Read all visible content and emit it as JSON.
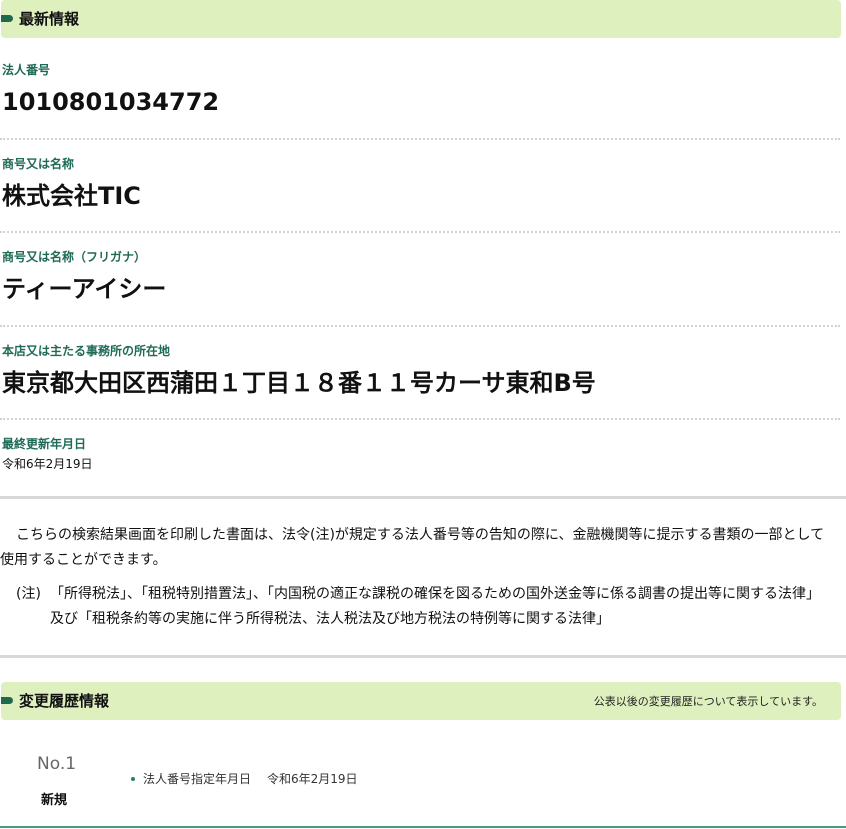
{
  "latest_info": {
    "header_title": "最新情報",
    "fields": [
      {
        "label": "法人番号",
        "value": "1010801034772"
      },
      {
        "label": "商号又は名称",
        "value": "株式会社TIC"
      },
      {
        "label": "商号又は名称（フリガナ）",
        "value": "ティーアイシー"
      },
      {
        "label": "本店又は主たる事務所の所在地",
        "value": "東京都大田区西蒲田１丁目１８番１１号カーサ東和B号"
      },
      {
        "label": "最終更新年月日",
        "value": "令和6年2月19日"
      }
    ]
  },
  "notice": {
    "paragraph": "こちらの検索結果画面を印刷した書面は、法令(注)が規定する法人番号等の告知の際に、金融機関等に提示する書類の一部として使用することができます。",
    "note_mark": "(注)",
    "note_text": "「所得税法」、「租税特別措置法」、「内国税の適正な課税の確保を図るための国外送金等に係る調書の提出等に関する法律」及び「租税条約等の実施に伴う所得税法、法人税法及び地方税法の特例等に関する法律」"
  },
  "history": {
    "header_title": "変更履歴情報",
    "header_note": "公表以後の変更履歴について表示しています。",
    "entries": [
      {
        "number": "No.1",
        "status": "新規",
        "item_label": "法人番号指定年月日",
        "item_value": "令和6年2月19日"
      }
    ]
  },
  "colors": {
    "header_bg": "#dff0bf",
    "marker": "#1f6a4f",
    "label": "#1e6a56",
    "bullet": "#2f7f5f"
  }
}
